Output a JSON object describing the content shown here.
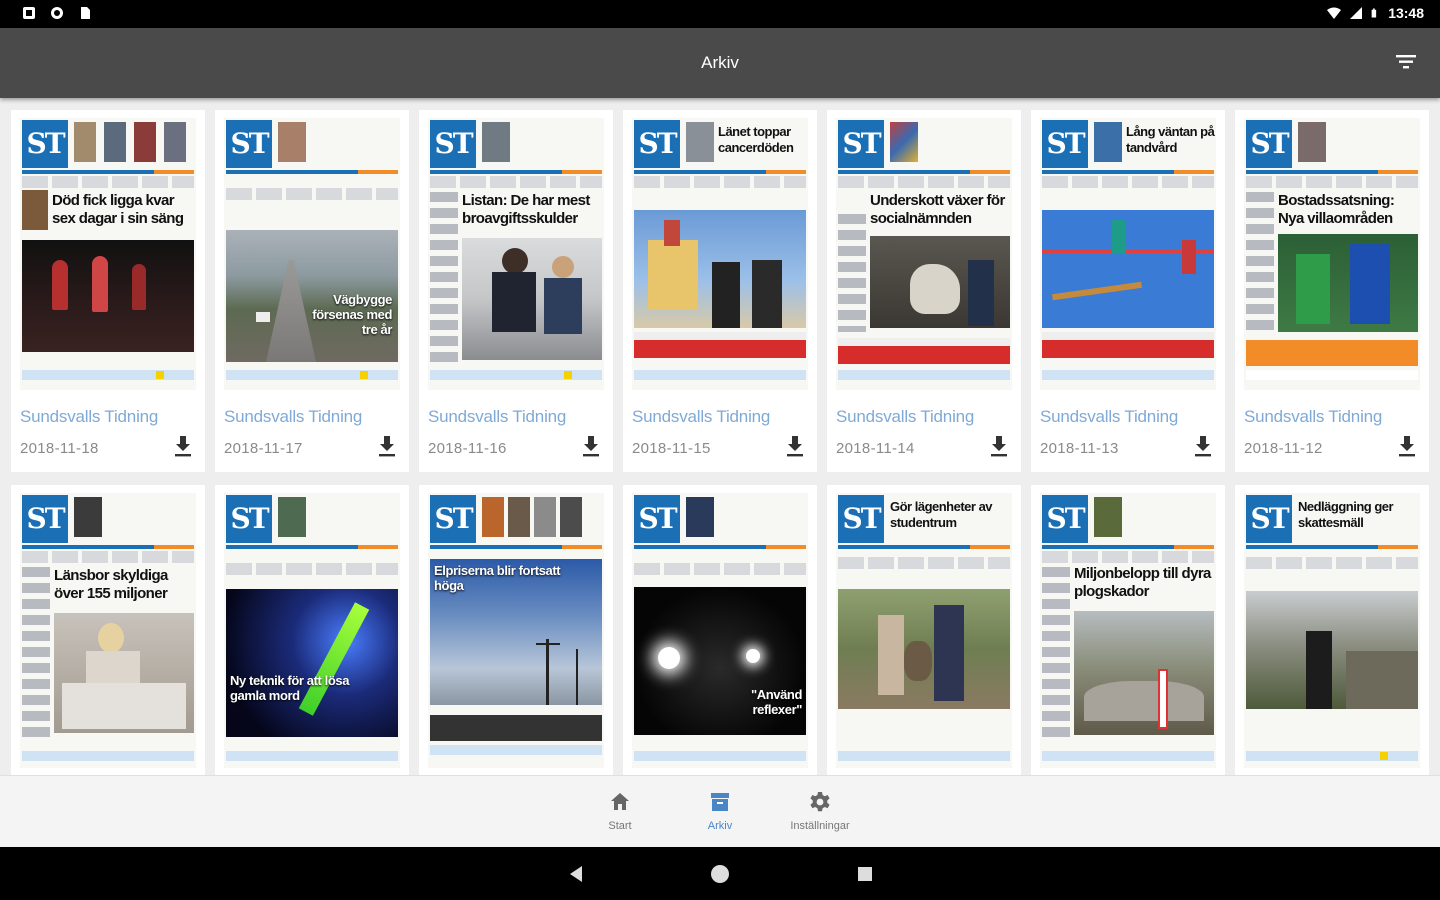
{
  "status_bar": {
    "time": "13:48"
  },
  "app_bar": {
    "title": "Arkiv",
    "filter_icon": "filter-icon"
  },
  "issues": [
    {
      "publication": "Sundsvalls Tidning",
      "date": "2018-11-18",
      "headline": "Död fick ligga kvar sex dagar i sin säng",
      "teaser_big": "",
      "overlay": ""
    },
    {
      "publication": "Sundsvalls Tidning",
      "date": "2018-11-17",
      "headline": "",
      "teaser_big": "",
      "overlay": "Vägbygge försenas med tre år"
    },
    {
      "publication": "Sundsvalls Tidning",
      "date": "2018-11-16",
      "headline": "Listan: De har mest broavgiftsskulder",
      "teaser_big": "",
      "overlay": ""
    },
    {
      "publication": "Sundsvalls Tidning",
      "date": "2018-11-15",
      "headline": "",
      "teaser_big": "Länet toppar cancerdöden",
      "overlay": ""
    },
    {
      "publication": "Sundsvalls Tidning",
      "date": "2018-11-14",
      "headline": "Underskott växer för socialnämnden",
      "teaser_big": "",
      "overlay": ""
    },
    {
      "publication": "Sundsvalls Tidning",
      "date": "2018-11-13",
      "headline": "",
      "teaser_big": "Lång väntan på tandvård",
      "overlay": ""
    },
    {
      "publication": "Sundsvalls Tidning",
      "date": "2018-11-12",
      "headline": "Bostadssatsning: Nya villaområden",
      "teaser_big": "",
      "overlay": ""
    },
    {
      "headline": "Länsbor skyldiga över 155 miljoner",
      "teaser_big": "",
      "overlay": ""
    },
    {
      "headline": "",
      "teaser_big": "",
      "overlay": "Ny teknik för att lösa gamla mord"
    },
    {
      "headline": "",
      "teaser_big": "",
      "overlay": "Elpriserna blir fortsatt höga"
    },
    {
      "headline": "",
      "teaser_big": "",
      "overlay": "\"Använd reflexer\""
    },
    {
      "headline": "",
      "teaser_big": "Gör lägenheter av studentrum",
      "overlay": ""
    },
    {
      "headline": "Miljonbelopp till dyra plogskador",
      "teaser_big": "",
      "overlay": ""
    },
    {
      "headline": "",
      "teaser_big": "Nedläggning ger skattesmäll",
      "overlay": ""
    }
  ],
  "masthead": "ST",
  "bottom_nav": [
    {
      "label": "Start",
      "icon": "home-icon"
    },
    {
      "label": "Arkiv",
      "icon": "archive-icon",
      "active": true
    },
    {
      "label": "Inställningar",
      "icon": "gear-icon"
    }
  ],
  "colors": {
    "accent": "#4a86c5",
    "app_bar": "#4a4a4a",
    "masthead_blue": "#1a6fb5"
  }
}
